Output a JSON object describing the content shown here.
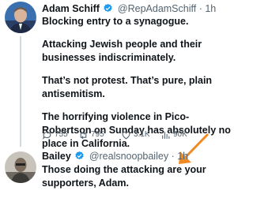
{
  "tweets": [
    {
      "display_name": "Adam Schiff",
      "handle": "@RepAdamSchiff",
      "separator": "·",
      "time": "1h",
      "paragraphs": [
        "Blocking entry to a synagogue.",
        "Attacking Jewish people and their businesses indiscriminately.",
        "That’s not protest. That’s pure, plain antisemitism.",
        "The horrifying violence in Pico-Robertson on Sunday has absolutely no place in California."
      ],
      "metrics": {
        "replies": "755",
        "reposts": "795",
        "likes": "3.1K",
        "views": "90K"
      }
    },
    {
      "display_name": "Bailey",
      "handle": "@realsnoopbailey",
      "separator": "·",
      "time": "1h",
      "paragraphs": [
        "Those doing the attacking are your supporters, Adam."
      ]
    }
  ],
  "colors": {
    "verified": "#1d9bf0",
    "annotation_arrow": "#f08a24",
    "muted_text": "#536471"
  },
  "icons": [
    "verified-badge-icon",
    "reply-icon",
    "repost-icon",
    "like-icon",
    "views-icon",
    "arrow-annotation"
  ]
}
